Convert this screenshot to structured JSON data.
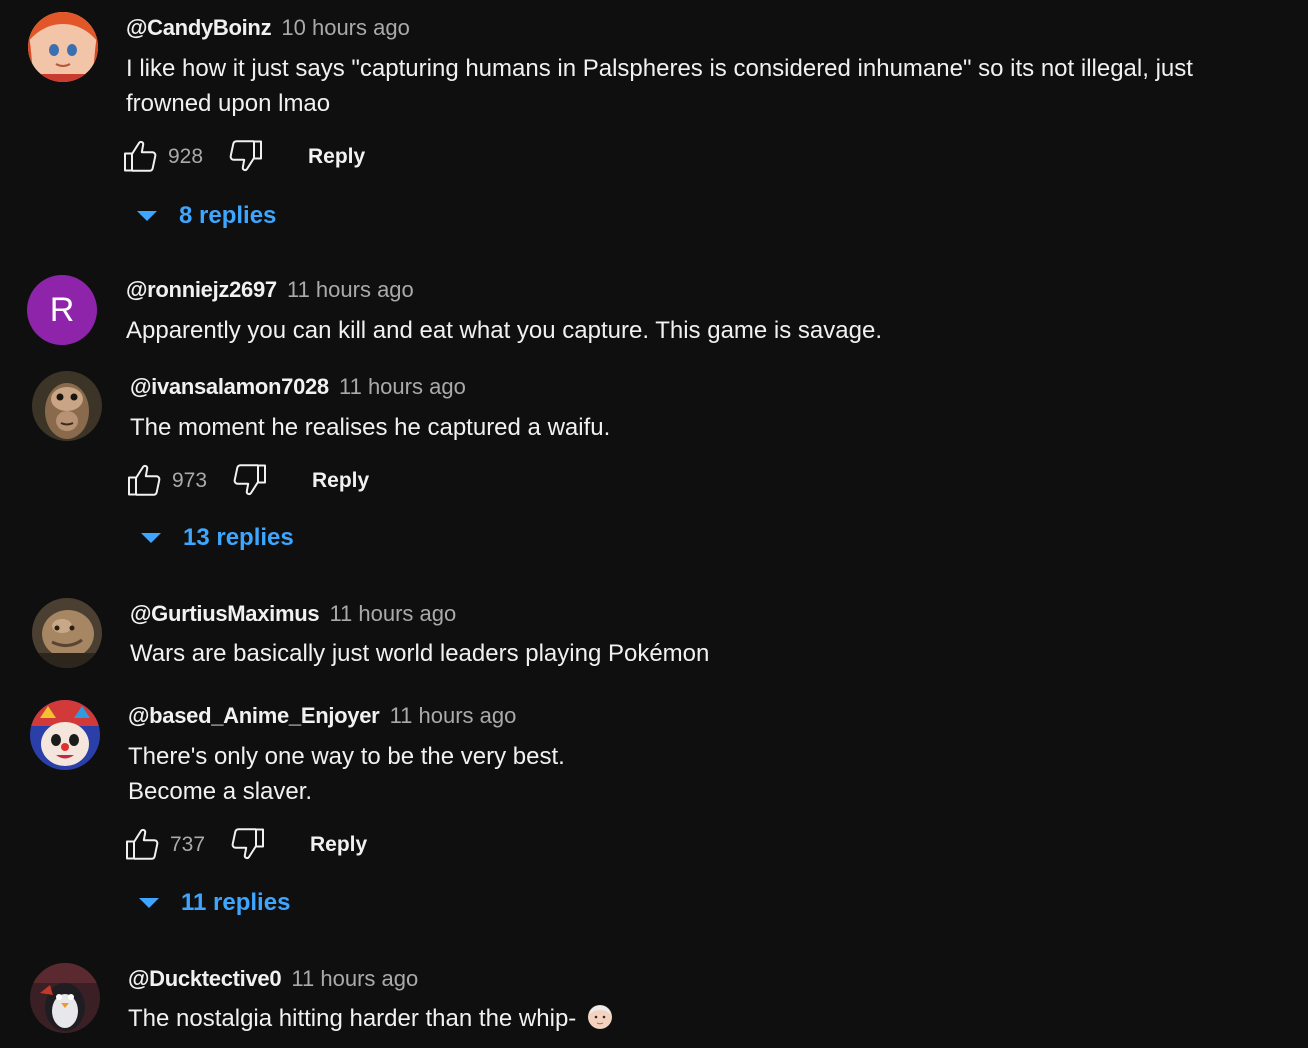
{
  "comments": [
    {
      "author": "@CandyBoinz",
      "time": "10 hours ago",
      "lines": [
        "I like how it just says \"capturing humans in Palspheres is considered inhumane\" so its not illegal, just",
        "frowned upon lmao"
      ],
      "likes": "928",
      "reply_label": "Reply",
      "replies_label": "8 replies",
      "avatar_icon": "anime-avatar-icon"
    },
    {
      "author": "@ronniejz2697",
      "time": "11 hours ago",
      "lines": [
        "Apparently you can kill and eat what you capture. This game is savage."
      ],
      "avatar_letter": "R",
      "avatar_color": "#8e24aa"
    },
    {
      "author": "@ivansalamon7028",
      "time": "11 hours ago",
      "lines": [
        "The moment he realises he captured a waifu."
      ],
      "likes": "973",
      "reply_label": "Reply",
      "replies_label": "13 replies",
      "avatar_icon": "monkey-face-avatar-icon"
    },
    {
      "author": "@GurtiusMaximus",
      "time": "11 hours ago",
      "lines": [
        "Wars are basically just world leaders playing Pokémon"
      ],
      "avatar_icon": "photo-avatar-icon"
    },
    {
      "author": "@based_Anime_Enjoyer",
      "time": "11 hours ago",
      "lines": [
        "There's only one way to be the very best.",
        "Become a slaver."
      ],
      "likes": "737",
      "reply_label": "Reply",
      "replies_label": "11 replies",
      "avatar_icon": "clown-avatar-icon"
    },
    {
      "author": "@Ducktective0",
      "time": "11 hours ago",
      "lines": [
        "The nostalgia hitting harder than the whip-"
      ],
      "avatar_icon": "penguin-avatar-icon",
      "emoji_icon": "older-man-emoji-icon"
    }
  ],
  "colors": {
    "background": "#0f0f0f",
    "text": "#f1f1f1",
    "secondary": "#aaaaaa",
    "link": "#3ea6ff"
  },
  "icons": {
    "like": "thumbs-up-icon",
    "dislike": "thumbs-down-icon",
    "expand": "caret-down-icon"
  }
}
